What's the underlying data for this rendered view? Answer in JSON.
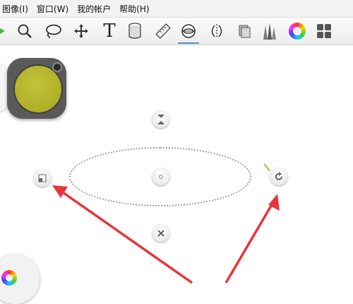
{
  "menu": {
    "items": [
      {
        "label": "图像(I)"
      },
      {
        "label": "窗口(W)"
      },
      {
        "label": "我的帐户"
      },
      {
        "label": "帮助(H)"
      }
    ]
  },
  "toolbar": {
    "tools": [
      {
        "name": "play-icon"
      },
      {
        "name": "magnify-icon"
      },
      {
        "name": "lasso-icon"
      },
      {
        "name": "move-icon"
      },
      {
        "name": "text-tool-icon",
        "glyph": "T"
      },
      {
        "name": "bucket-icon"
      },
      {
        "name": "ruler-icon"
      },
      {
        "name": "ellipse-guide-icon",
        "active": true
      },
      {
        "name": "symmetry-icon"
      },
      {
        "name": "layers-icon"
      },
      {
        "name": "brush-library-icon"
      },
      {
        "name": "color-wheel-icon"
      },
      {
        "name": "copic-library-icon"
      }
    ],
    "active_color": "#4a90c8"
  },
  "canvas": {
    "color_puck_color": "#b5b52c",
    "guide_handles": [
      "scale-handle",
      "rotate-handle",
      "flip-handle",
      "center-handle",
      "close-handle"
    ],
    "annotation_arrow_color": "#e8343a"
  }
}
